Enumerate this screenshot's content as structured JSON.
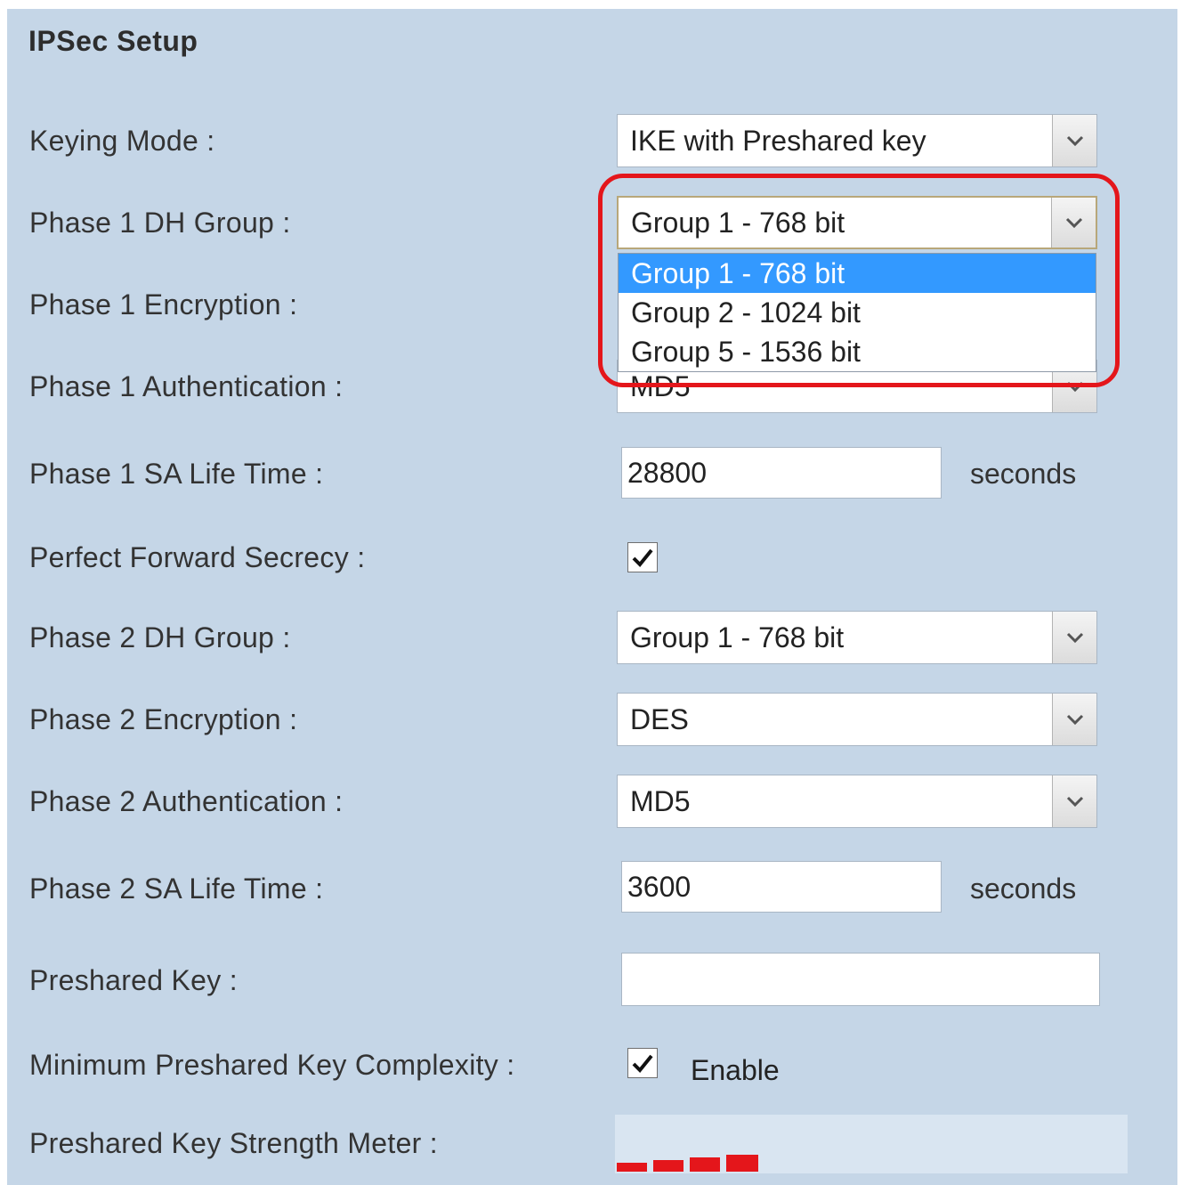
{
  "section": {
    "title": "IPSec Setup"
  },
  "fields": {
    "keying_mode": {
      "label": "Keying Mode :",
      "value": "IKE with Preshared key"
    },
    "phase1_dh_group": {
      "label": "Phase 1 DH Group :",
      "value": "Group 1 - 768 bit",
      "options": [
        "Group 1 - 768 bit",
        "Group 2 - 1024 bit",
        "Group 5 - 1536 bit"
      ]
    },
    "phase1_encryption": {
      "label": "Phase 1 Encryption :"
    },
    "phase1_authentication": {
      "label": "Phase 1 Authentication :",
      "value": "MD5"
    },
    "phase1_sa_lifetime": {
      "label": "Phase 1 SA Life Time :",
      "value": "28800",
      "suffix": "seconds"
    },
    "pfs": {
      "label": "Perfect Forward Secrecy :",
      "checked": true
    },
    "phase2_dh_group": {
      "label": "Phase 2 DH Group :",
      "value": "Group 1 - 768 bit"
    },
    "phase2_encryption": {
      "label": "Phase 2 Encryption :",
      "value": "DES"
    },
    "phase2_authentication": {
      "label": "Phase 2 Authentication :",
      "value": "MD5"
    },
    "phase2_sa_lifetime": {
      "label": "Phase 2 SA Life Time :",
      "value": "3600",
      "suffix": "seconds"
    },
    "preshared_key": {
      "label": "Preshared Key :",
      "value": ""
    },
    "min_complexity": {
      "label": "Minimum Preshared Key Complexity :",
      "checked": true,
      "enable_label": "Enable"
    },
    "strength_meter": {
      "label": "Preshared Key Strength Meter :",
      "segments": 4
    }
  },
  "icons": {
    "dropdown": "chevron-down-icon",
    "check": "checkmark-icon"
  },
  "colors": {
    "panel": "#c5d6e7",
    "selected_option": "#3399ff",
    "highlight_ring": "#e4161b",
    "meter": "#e4161b"
  }
}
